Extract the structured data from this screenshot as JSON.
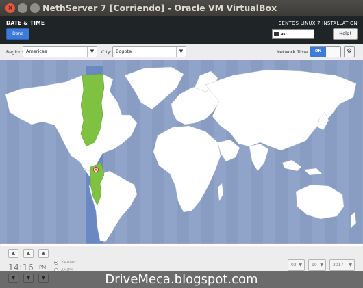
{
  "window": {
    "title": "NethServer 7 [Corriendo] - Oracle VM VirtualBox",
    "close_glyph": "×"
  },
  "header": {
    "spoke_title": "DATE & TIME",
    "done_label": "Done",
    "product_title": "CENTOS LINUX 7 INSTALLATION",
    "keyboard_layout": "us",
    "help_label": "Help!"
  },
  "controls": {
    "region_label": "Region:",
    "region_value": "Americas",
    "city_label": "City:",
    "city_value": "Bogota",
    "network_time_label": "Network Time",
    "network_time_state": "ON",
    "arrow_glyph": "▼",
    "gear_glyph": "⚙"
  },
  "map": {
    "ocean_color": "#8fa4c8",
    "land_color": "#ffffff",
    "selected_zone_color": "#7fc241",
    "selected_band_color": "#6a88c2"
  },
  "time": {
    "hours": "14",
    "minutes": "16",
    "separator": ":",
    "ampm": "PM",
    "format_24h_label": "24-hour",
    "format_ampm_label": "AM/PM",
    "up_glyph": "▲",
    "down_glyph": "▼"
  },
  "date": {
    "month": "02",
    "day": "10",
    "year": "2017"
  },
  "watermark": {
    "text": "DriveMeca.blogspot.com"
  }
}
